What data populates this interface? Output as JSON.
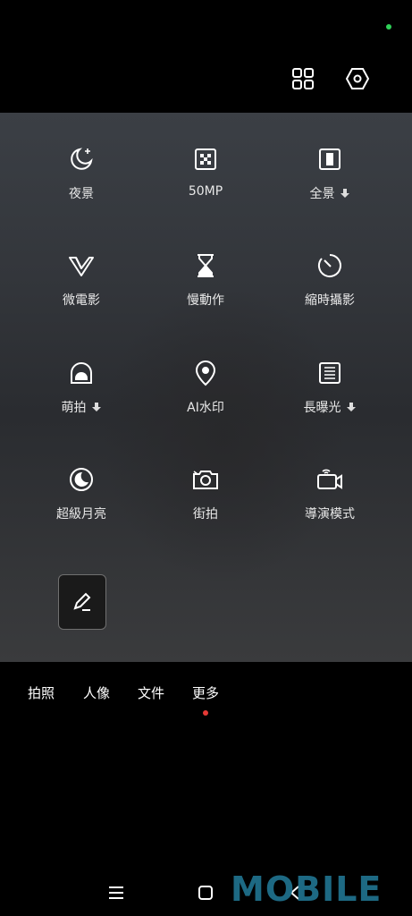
{
  "modes": [
    {
      "icon": "moon-star-icon",
      "label": "夜景",
      "download": false
    },
    {
      "icon": "dice-grid-icon",
      "label": "50MP",
      "download": false
    },
    {
      "icon": "panorama-icon",
      "label": "全景",
      "download": true
    },
    {
      "icon": "vlog-v-icon",
      "label": "微電影",
      "download": false
    },
    {
      "icon": "hourglass-icon",
      "label": "慢動作",
      "download": false
    },
    {
      "icon": "timer-dial-icon",
      "label": "縮時攝影",
      "download": false
    },
    {
      "icon": "cute-face-icon",
      "label": "萌拍",
      "download": true
    },
    {
      "icon": "location-pin-icon",
      "label": "AI水印",
      "download": false
    },
    {
      "icon": "long-exposure-icon",
      "label": "長曝光",
      "download": true
    },
    {
      "icon": "moon-crescent-icon",
      "label": "超級月亮",
      "download": false
    },
    {
      "icon": "street-camera-icon",
      "label": "街拍",
      "download": false
    },
    {
      "icon": "director-camera-icon",
      "label": "導演模式",
      "download": false
    }
  ],
  "tabs": [
    {
      "label": "拍照"
    },
    {
      "label": "人像"
    },
    {
      "label": "文件"
    },
    {
      "label": "更多",
      "active": true
    }
  ],
  "watermark": "MOBILE",
  "colors": {
    "status_dot": "#2fd158",
    "active_tab_dot": "#e53935",
    "watermark": "#1f6f8b"
  }
}
